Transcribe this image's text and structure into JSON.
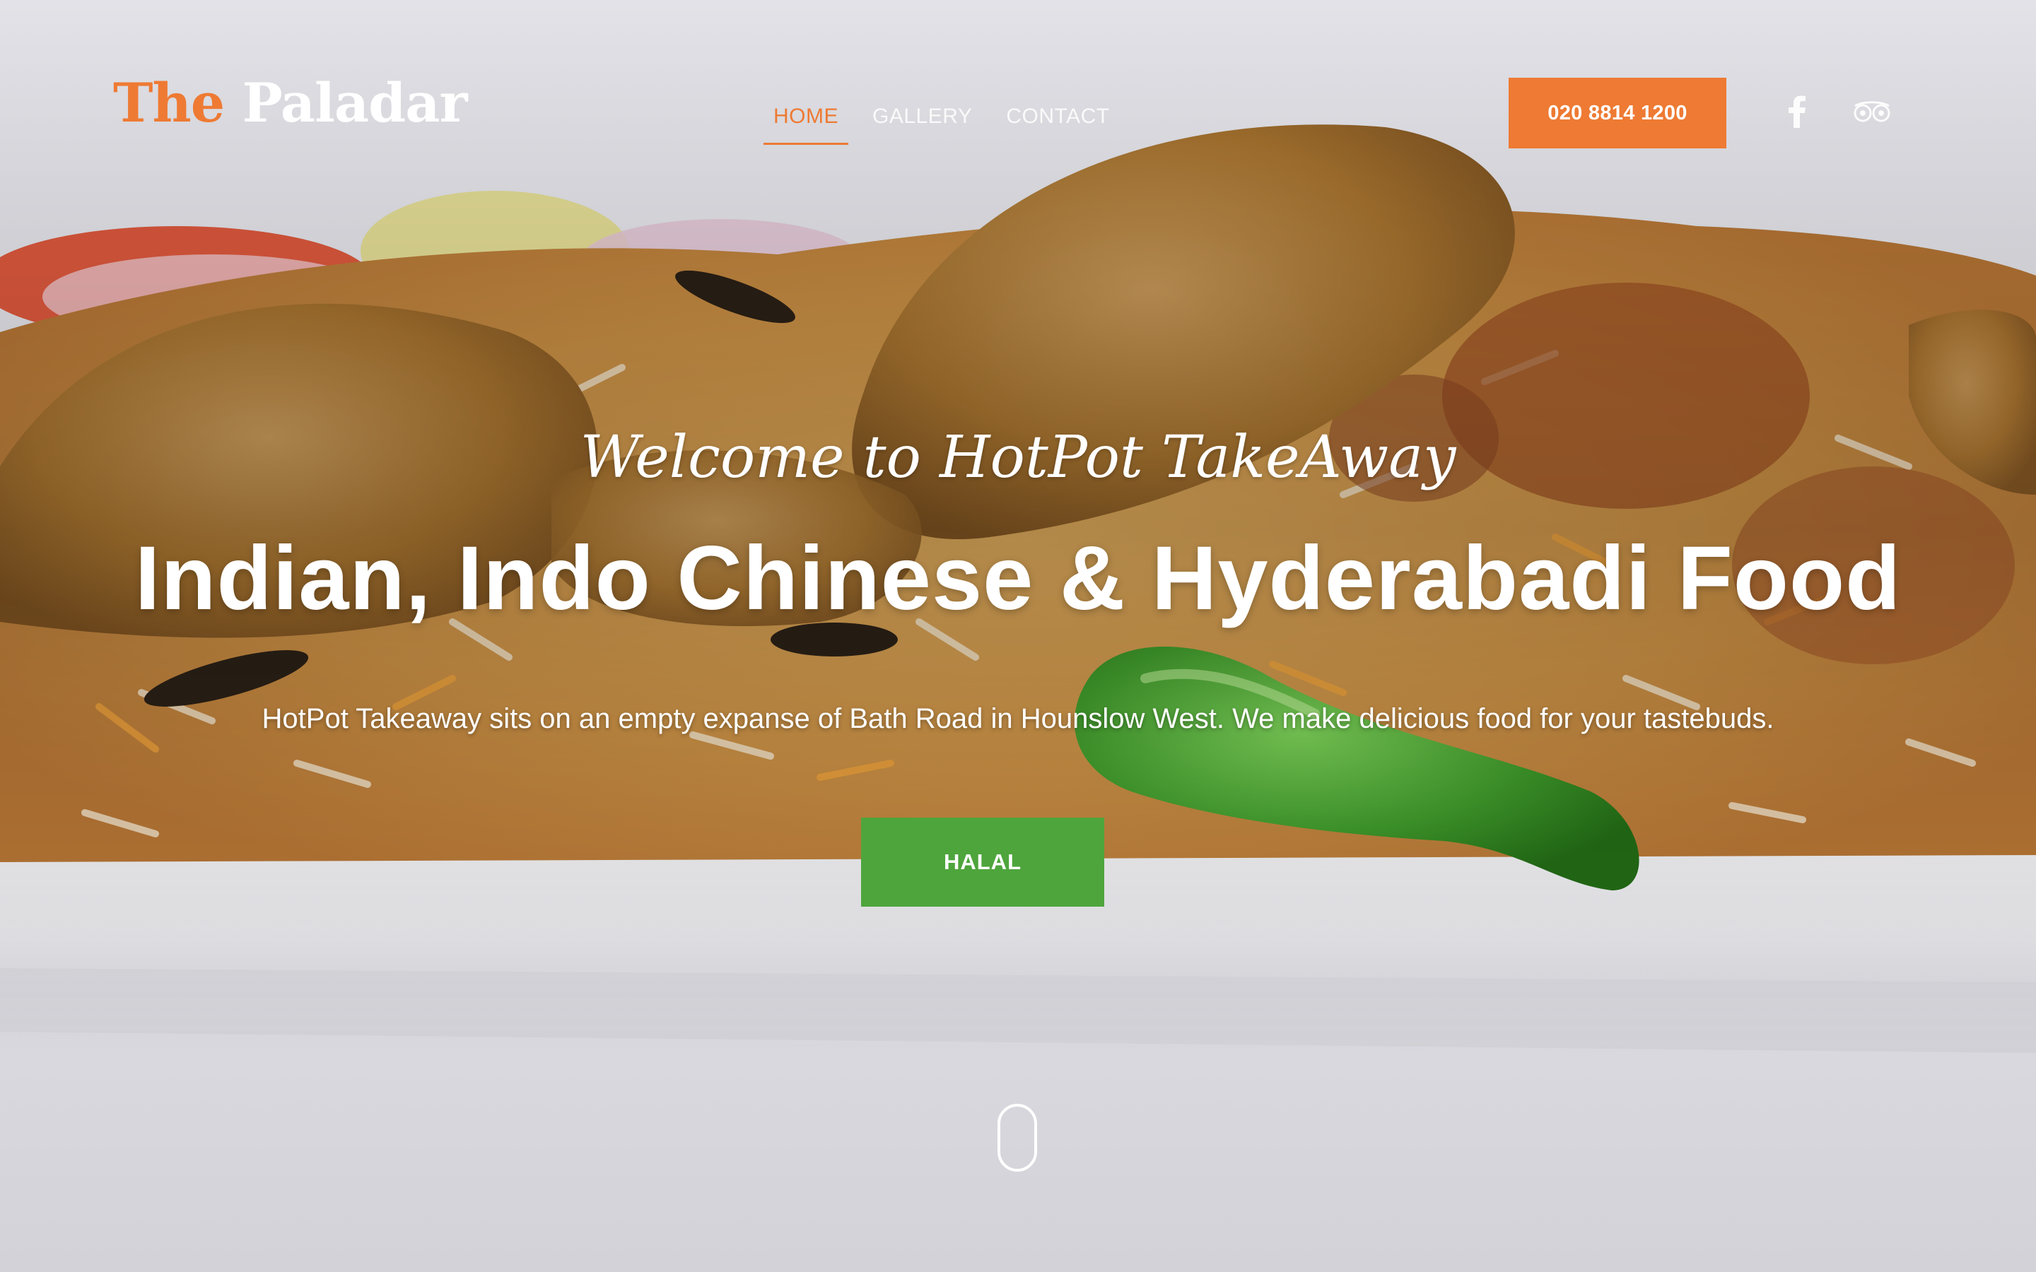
{
  "header": {
    "logo_the": "The",
    "logo_name": "Paladar",
    "nav": [
      {
        "label": "HOME",
        "active": true
      },
      {
        "label": "GALLERY",
        "active": false
      },
      {
        "label": "CONTACT",
        "active": false
      }
    ],
    "phone_label": "020 8814 1200",
    "social": [
      "facebook-icon",
      "tripadvisor-icon"
    ]
  },
  "hero": {
    "welcome": "Welcome to HotPot TakeAway",
    "headline": "Indian, Indo Chinese & Hyderabadi Food",
    "tagline": "HotPot Takeaway sits on an empty expanse of Bath Road in Hounslow West. We make delicious food for your tastebuds.",
    "cta_label": "HALAL",
    "image": "biryani-with-chicken-and-green-chili"
  },
  "colors": {
    "accent": "#ee7a33",
    "halal_green": "#4ea53c",
    "text_light": "#ffffff"
  }
}
